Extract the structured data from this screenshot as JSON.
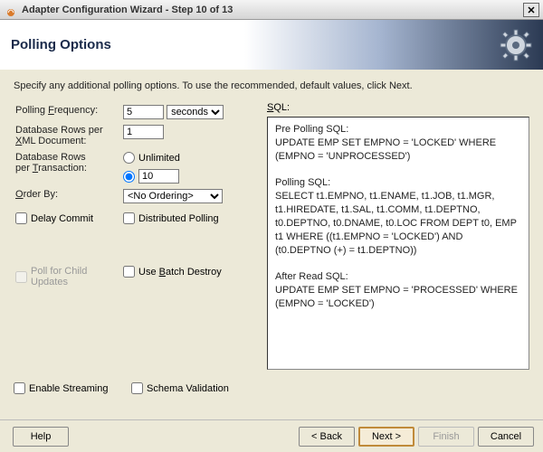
{
  "window": {
    "title": "Adapter Configuration Wizard - Step 10 of 13"
  },
  "banner": {
    "title": "Polling Options"
  },
  "intro": "Specify any additional polling options.  To use the recommended, default values, click Next.",
  "labels": {
    "pollingFreq": "Polling Frequency:",
    "pollingFreqU": "F",
    "dbRowsXml1": "Database Rows per",
    "dbRowsXml2": "XML Document:",
    "dbRowsXmlU": "X",
    "dbRowsTx1": "Database Rows",
    "dbRowsTx2": "per Transaction:",
    "dbRowsTxU": "T",
    "unlimited": "Unlimited",
    "orderBy": "Order By:",
    "orderByU": "O",
    "delayCommit": "Delay Commit",
    "distributedPolling": "Distributed Polling",
    "pollChild": "Poll for Child Updates",
    "useBatchDestroy": "Use Batch Destroy",
    "useBatchDestroyU": "B",
    "enableStreaming": "Enable Streaming",
    "schemaValidation": "Schema Validation",
    "sql": "SQL:",
    "sqlU": "S"
  },
  "values": {
    "pollingFreq": "5",
    "unit": "seconds",
    "rowsXml": "1",
    "unlimitedSelected": false,
    "limitedSelected": true,
    "rowsTx": "10",
    "orderBy": "<No Ordering>"
  },
  "sql": {
    "prePollingLabel": "Pre Polling SQL:",
    "prePolling": "UPDATE EMP SET EMPNO = 'LOCKED' WHERE (EMPNO = 'UNPROCESSED')",
    "pollingLabel": "Polling SQL:",
    "polling": "SELECT t1.EMPNO, t1.ENAME, t1.JOB, t1.MGR, t1.HIREDATE, t1.SAL, t1.COMM, t1.DEPTNO, t0.DEPTNO, t0.DNAME, t0.LOC FROM DEPT t0, EMP t1 WHERE ((t1.EMPNO = 'LOCKED') AND (t0.DEPTNO (+) = t1.DEPTNO))",
    "afterLabel": "After Read SQL:",
    "after": "UPDATE EMP SET EMPNO = 'PROCESSED' WHERE (EMPNO = 'LOCKED')"
  },
  "buttons": {
    "help": "Help",
    "back": "< Back",
    "next": "Next >",
    "finish": "Finish",
    "cancel": "Cancel"
  }
}
